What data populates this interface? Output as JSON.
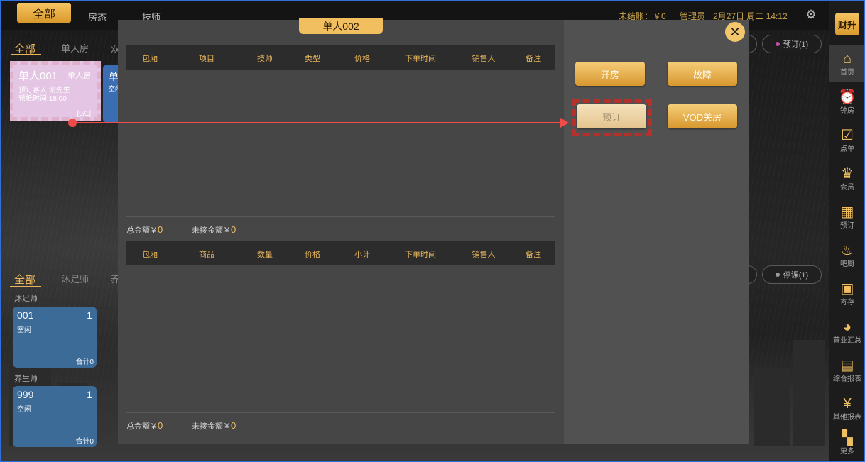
{
  "topbar": {
    "all_tab": "全部",
    "links": [
      "房态",
      "技师"
    ],
    "unsettled": "未结账：￥0",
    "user": "管理员",
    "datetime": "2月27日 周二 14:12",
    "gear_icon": "gear-icon"
  },
  "room_tabs": [
    "全部",
    "单人房",
    "双"
  ],
  "room_pill": "预订(1)",
  "room_card": {
    "name": "单人001",
    "type": "单人房",
    "booker": "预订客人:谢先生",
    "arrive": "预抵时间:18:00",
    "count": "[0/1]"
  },
  "room_card2": {
    "name": "单",
    "status": "空闲"
  },
  "staff_tabs": [
    "全部",
    "沐足师",
    "养"
  ],
  "staff_pill": "停课(1)",
  "staff_groups": [
    {
      "label": "沐足师",
      "num": "001",
      "count": "1",
      "status": "空闲",
      "sum": "合计0"
    },
    {
      "label": "养生师",
      "num": "999",
      "count": "1",
      "status": "空闲",
      "sum": "合计0"
    }
  ],
  "modal": {
    "title": "单人002",
    "table1_headers": [
      "包厢",
      "项目",
      "技师",
      "类型",
      "价格",
      "下单时间",
      "销售人",
      "备注"
    ],
    "table2_headers": [
      "包厢",
      "商品",
      "数量",
      "价格",
      "小计",
      "下单时间",
      "销售人",
      "备注"
    ],
    "total_label": "总金额￥",
    "total_value": "0",
    "unreceived_label": "未接金额￥",
    "unreceived_value": "0",
    "buttons": {
      "open": "开房",
      "fault": "故障",
      "book": "预订",
      "vod_close": "VOD关房"
    }
  },
  "sidebar": {
    "logo": "财升",
    "items": [
      {
        "label": "首页",
        "icon": "home-icon"
      },
      {
        "label": "钟房",
        "icon": "alarm-clock-icon"
      },
      {
        "label": "点单",
        "icon": "clipboard-check-icon"
      },
      {
        "label": "会员",
        "icon": "crown-icon"
      },
      {
        "label": "预订",
        "icon": "calendar-clock-icon"
      },
      {
        "label": "吧厨",
        "icon": "pot-icon"
      },
      {
        "label": "寄存",
        "icon": "storage-icon"
      },
      {
        "label": "营业汇总",
        "icon": "pie-chart-icon"
      },
      {
        "label": "综合报表",
        "icon": "bar-report-icon"
      },
      {
        "label": "其他报表",
        "icon": "money-report-icon"
      },
      {
        "label": "更多",
        "icon": "grid-more-icon"
      }
    ]
  }
}
